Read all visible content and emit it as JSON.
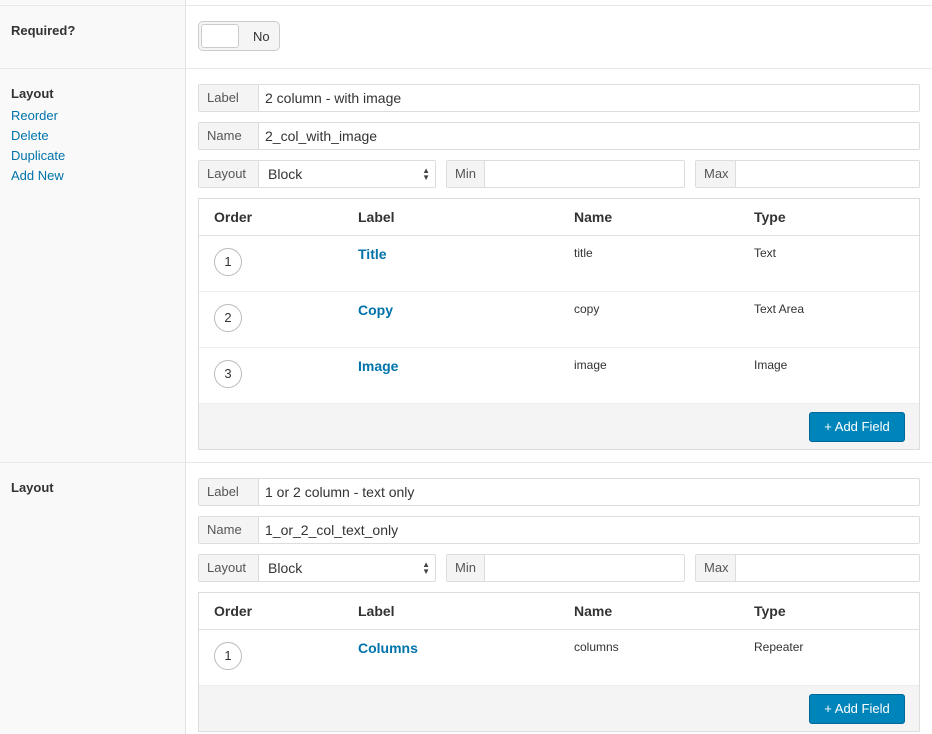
{
  "required": {
    "title": "Required?",
    "toggle_text": "No"
  },
  "layouts": [
    {
      "title": "Layout",
      "actions": [
        "Reorder",
        "Delete",
        "Duplicate",
        "Add New"
      ],
      "label_prefix": "Label",
      "label_value": "2 column - with image",
      "name_prefix": "Name",
      "name_value": "2_col_with_image",
      "layout_prefix": "Layout",
      "layout_value": "Block",
      "min_prefix": "Min",
      "min_value": "",
      "max_prefix": "Max",
      "max_value": "",
      "columns": [
        "Order",
        "Label",
        "Name",
        "Type"
      ],
      "fields": [
        {
          "order": "1",
          "label": "Title",
          "name": "title",
          "type": "Text"
        },
        {
          "order": "2",
          "label": "Copy",
          "name": "copy",
          "type": "Text Area"
        },
        {
          "order": "3",
          "label": "Image",
          "name": "image",
          "type": "Image"
        }
      ],
      "add_button": "+ Add Field"
    },
    {
      "title": "Layout",
      "label_prefix": "Label",
      "label_value": "1 or 2 column - text only",
      "name_prefix": "Name",
      "name_value": "1_or_2_col_text_only",
      "layout_prefix": "Layout",
      "layout_value": "Block",
      "min_prefix": "Min",
      "min_value": "",
      "max_prefix": "Max",
      "max_value": "",
      "columns": [
        "Order",
        "Label",
        "Name",
        "Type"
      ],
      "fields": [
        {
          "order": "1",
          "label": "Columns",
          "name": "columns",
          "type": "Repeater"
        }
      ],
      "add_button": "+ Add Field"
    }
  ]
}
